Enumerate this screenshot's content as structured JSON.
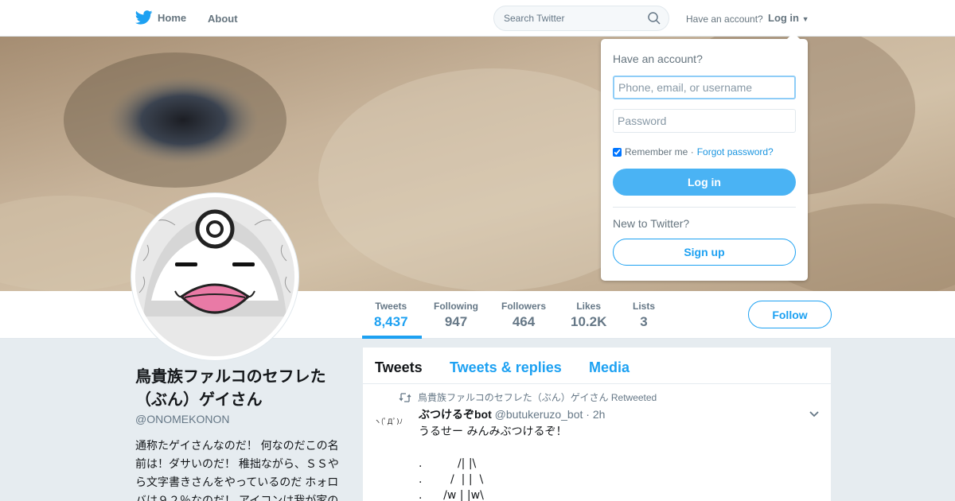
{
  "colors": {
    "accent": "#1da1f2",
    "button_blue": "#4ab3f4",
    "muted": "#657786",
    "background": "#e6ecf0"
  },
  "nav": {
    "home_label": "Home",
    "about_label": "About",
    "search_placeholder": "Search Twitter",
    "have_account": "Have an account?",
    "login_label": "Log in"
  },
  "profile": {
    "name": "鳥貴族ファルコのセフレた（ぶん）ゲイさん",
    "handle": "@ONOMEKONON",
    "bio": "通称たゲイさんなのだ！ 何なのだこの名前は！ダサいのだ！ 稚拙ながら、ＳＳやら文字書きさんをやっているのだ ホォロバは９２％なのだ！ アイコンは我が家の",
    "follow_label": "Follow"
  },
  "stats": [
    {
      "label": "Tweets",
      "value": "8,437"
    },
    {
      "label": "Following",
      "value": "947"
    },
    {
      "label": "Followers",
      "value": "464"
    },
    {
      "label": "Likes",
      "value": "10.2K"
    },
    {
      "label": "Lists",
      "value": "3"
    }
  ],
  "timeline": {
    "tabs": [
      "Tweets",
      "Tweets & replies",
      "Media"
    ],
    "tweet": {
      "retweeted_by": "鳥貴族ファルコのセフレた（ぶん）ゲイさん Retweeted",
      "author_name": "ぶつけるぞbot",
      "author_handle": "@butukeruzo_bot",
      "time": "· 2h",
      "avatar_text": "ヽ(ﾟДﾟ)ﾉ",
      "body": "うるせー みんみぶつけるぞ！\n\n.          /| |\\\n.        /  | |  \\\n.      /w | |w\\"
    }
  },
  "login_dropdown": {
    "title": "Have an account?",
    "username_placeholder": "Phone, email, or username",
    "password_placeholder": "Password",
    "remember_label": "Remember me ·",
    "forgot_label": "Forgot password?",
    "login_button": "Log in",
    "new_label": "New to Twitter?",
    "signup_button": "Sign up"
  }
}
